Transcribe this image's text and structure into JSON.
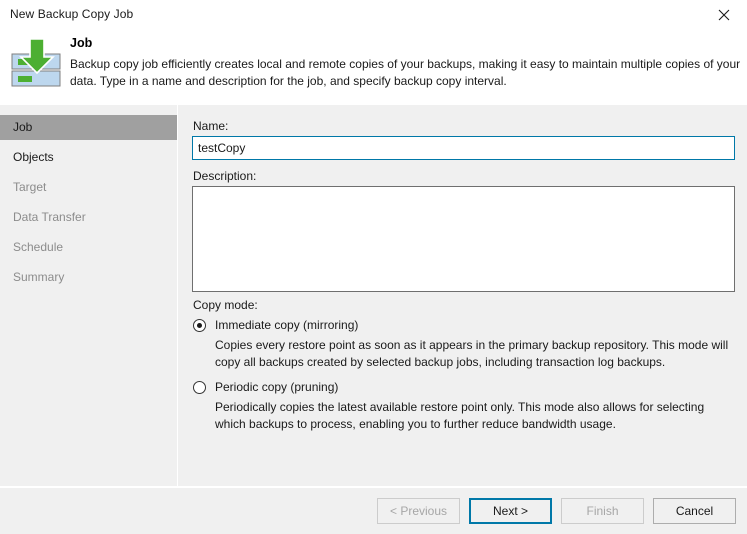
{
  "window": {
    "title": "New Backup Copy Job",
    "close_label": "close-icon"
  },
  "header": {
    "icon": "backup-copy-icon",
    "title": "Job",
    "description": "Backup copy job efficiently creates local and remote copies of your backups, making it easy to maintain multiple copies of your data. Type in a name and description for the job, and specify backup copy interval."
  },
  "sidebar": {
    "items": [
      {
        "label": "Job",
        "state": "selected"
      },
      {
        "label": "Objects",
        "state": "enabled"
      },
      {
        "label": "Target",
        "state": "disabled"
      },
      {
        "label": "Data Transfer",
        "state": "disabled"
      },
      {
        "label": "Schedule",
        "state": "disabled"
      },
      {
        "label": "Summary",
        "state": "disabled"
      }
    ]
  },
  "form": {
    "name_label": "Name:",
    "name_value": "testCopy",
    "name_placeholder": "",
    "description_label": "Description:",
    "description_value": "",
    "description_placeholder": "",
    "copy_mode_label": "Copy mode:",
    "options": [
      {
        "label": "Immediate copy (mirroring)",
        "description": "Copies every restore point as soon as it appears in the primary backup repository. This mode will copy all backups created by selected backup jobs, including transaction log backups.",
        "selected": true
      },
      {
        "label": "Periodic copy (pruning)",
        "description": "Periodically copies the latest available restore point only. This mode also allows for selecting which backups to process, enabling you to further reduce bandwidth usage.",
        "selected": false
      }
    ]
  },
  "footer": {
    "previous_label": "< Previous",
    "next_label": "Next >",
    "finish_label": "Finish",
    "cancel_label": "Cancel"
  },
  "colors": {
    "accent": "#0078a8",
    "dialog_bg": "#f0f0f0",
    "header_bg": "#ffffff",
    "selected_item_bg": "#a0a0a0",
    "icon_green": "#4caf32",
    "icon_blue": "#bdd7ee"
  }
}
